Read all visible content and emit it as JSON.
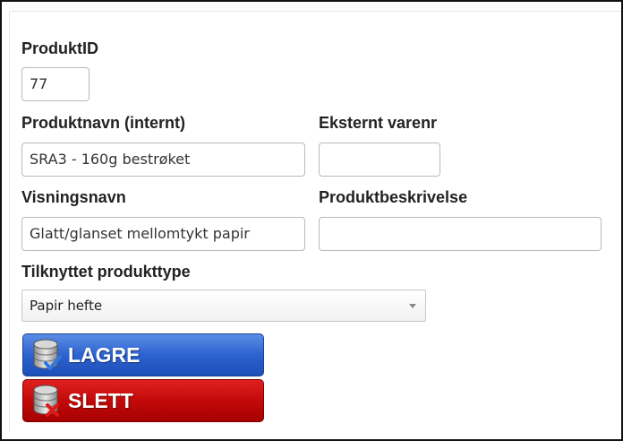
{
  "form": {
    "produkt_id": {
      "label": "ProduktID",
      "value": "77"
    },
    "produktnavn": {
      "label": "Produktnavn (internt)",
      "value": "SRA3 - 160g bestrøket"
    },
    "eksternt_varenr": {
      "label": "Eksternt varenr",
      "value": ""
    },
    "visningsnavn": {
      "label": "Visningsnavn",
      "value": "Glatt/glanset mellomtykt papir"
    },
    "produktbeskrivelse": {
      "label": "Produktbeskrivelse",
      "value": ""
    },
    "produkttype": {
      "label": "Tilknyttet produkttype",
      "selected": "Papir hefte"
    }
  },
  "buttons": {
    "save_label": "LAGRE",
    "delete_label": "SLETT"
  },
  "icons": {
    "save": "database-check-icon",
    "delete": "database-x-icon"
  },
  "colors": {
    "save_button": "#2d63cf",
    "delete_button": "#c20a0a"
  }
}
